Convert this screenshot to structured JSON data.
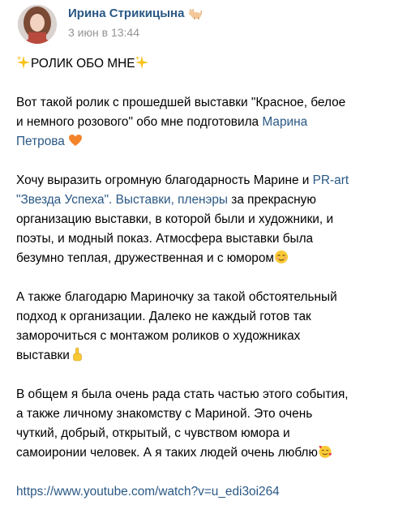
{
  "post": {
    "author": {
      "name": "Ирина Стрикицына",
      "name_icon": "cat-icon"
    },
    "time": "3 июн в 13:44",
    "colors": {
      "link": "#2a5885",
      "time": "#939393",
      "text": "#000000"
    },
    "text": {
      "title": "РОЛИК ОБО МНЕ",
      "p1_l1": "Вот такой ролик с прошедшей выставки \"Красное, белое",
      "p1_l2_a": "и немного розового\" обо мне подготовила ",
      "p1_link_marina_1": "Марина",
      "p1_link_marina_2": "Петрова",
      "p2_l1_a": "Хочу выразить огромную благодарность Марине и ",
      "p2_link_pr_1": "PR-art",
      "p2_link_pr_2": "\"Звезда Успеха\". Выставки, пленэры",
      "p2_l2_b": " за прекрасную",
      "p2_l3": "организацию выставки, в которой были и художники, и",
      "p2_l4": "поэты, и модный показ. Атмосфера выставки была",
      "p2_l5": "безумно теплая, дружественная и с юмором",
      "p3_l1": "А также благодарю Мариночку за такой обстоятельный",
      "p3_l2": "подход к организации. Далеко не каждый готов так",
      "p3_l3": "заморочиться с монтажом роликов о художниках",
      "p3_l4": "выставки",
      "p4_l1": "В общем я была очень рада стать частью этого события,",
      "p4_l2": "а также личному знакомству с Мариной. Это очень",
      "p4_l3": "чуткий, добрый, открытый, с чувством юмора и",
      "p4_l4": "самоиронии человек. А я таких людей очень люблю",
      "url": "https://www.youtube.com/watch?v=u_edi3oi264"
    },
    "emojis": {
      "sparkles": "sparkles-icon",
      "heart": "orange-heart-icon",
      "relieved": "relieved-face-icon",
      "point_up": "point-up-icon",
      "hearts_face": "smiling-face-with-hearts-icon"
    }
  }
}
